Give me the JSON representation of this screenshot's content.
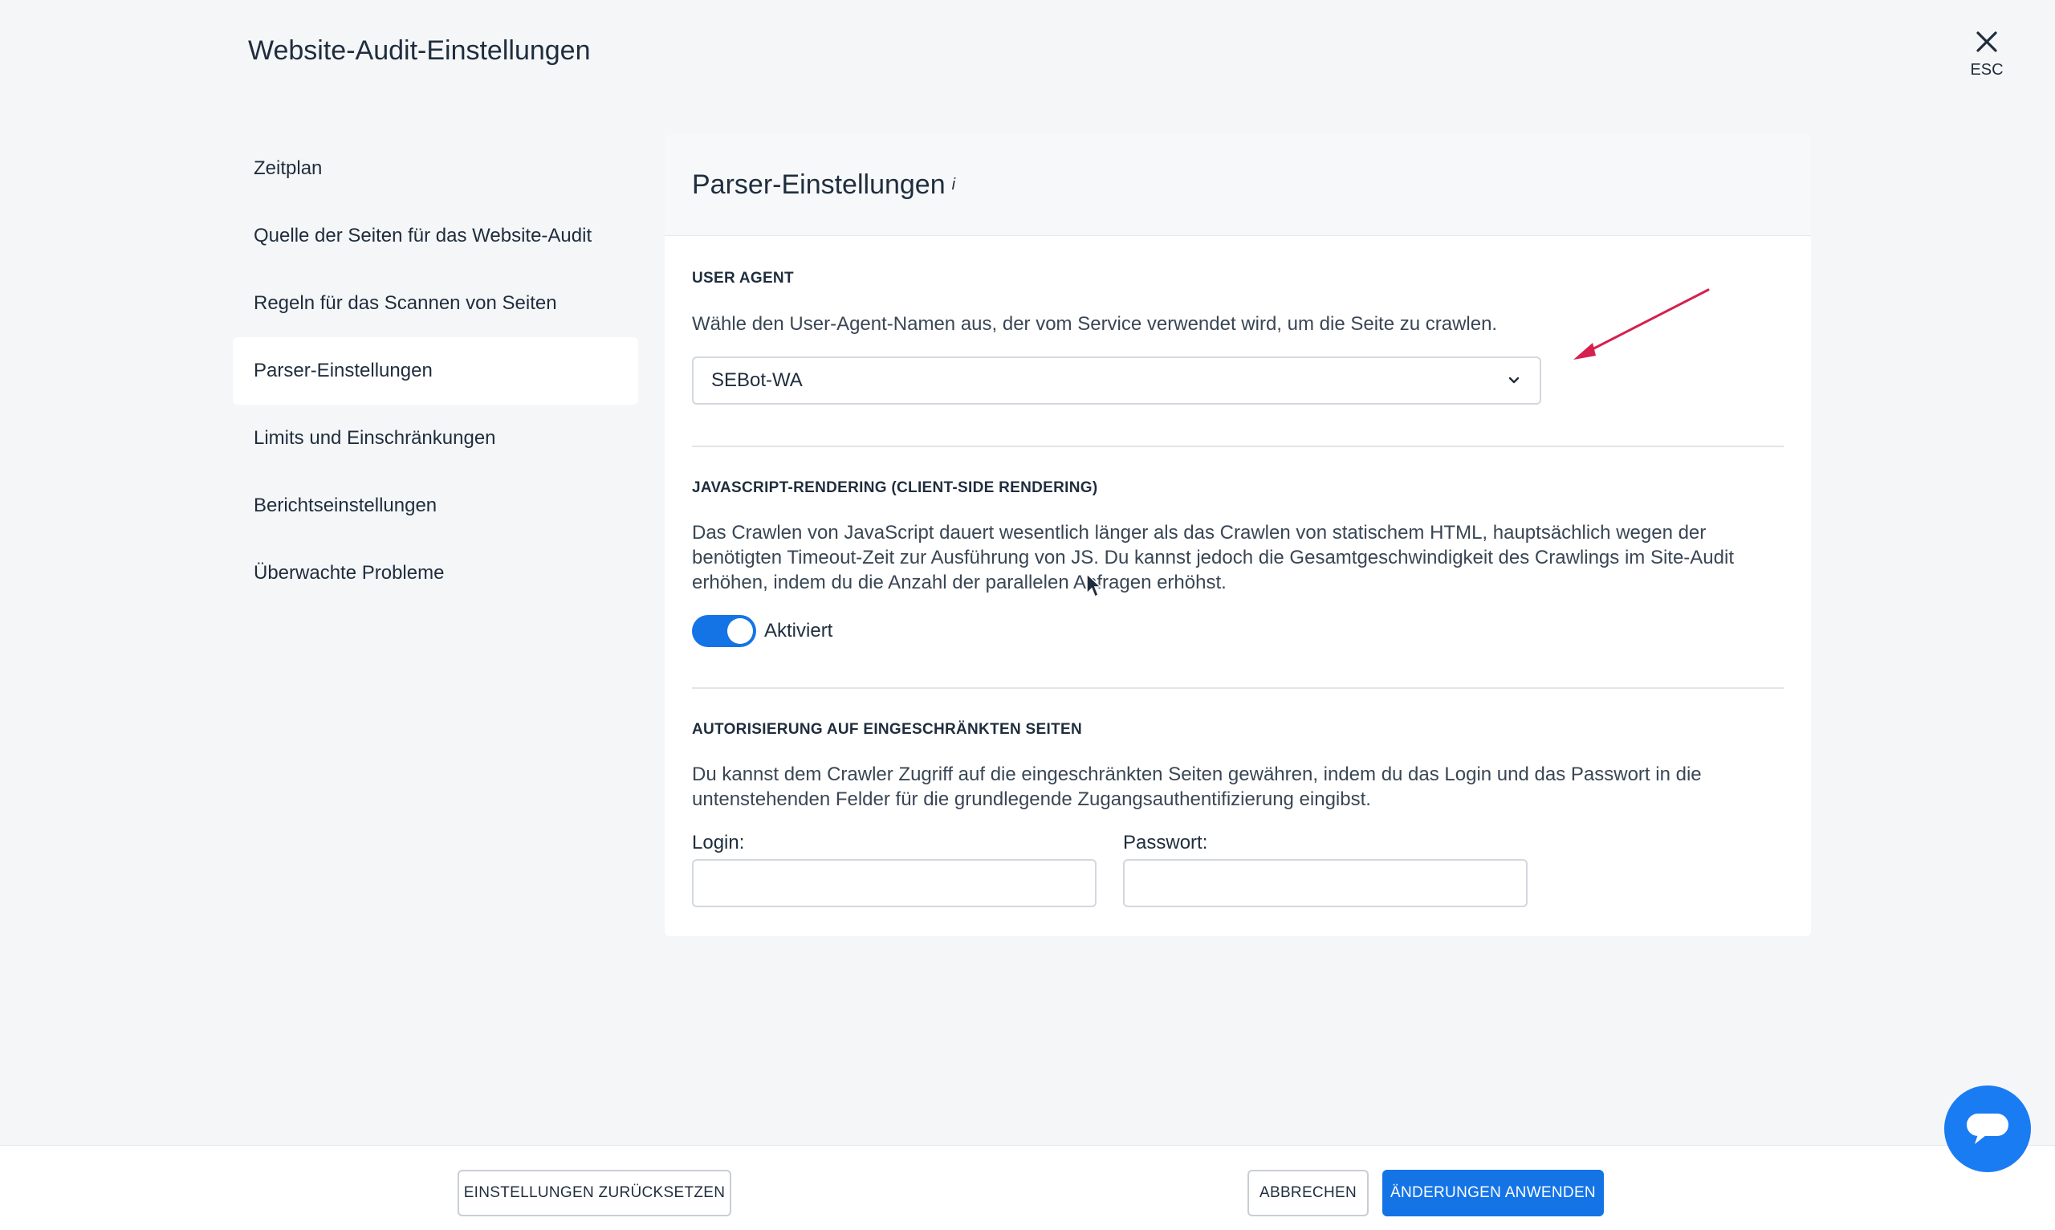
{
  "modal": {
    "title": "Website-Audit-Einstellungen",
    "close_label": "ESC"
  },
  "sidebar": {
    "items": [
      {
        "label": "Zeitplan",
        "active": false
      },
      {
        "label": "Quelle der Seiten für das Website-Audit",
        "active": false
      },
      {
        "label": "Regeln für das Scannen von Seiten",
        "active": false
      },
      {
        "label": "Parser-Einstellungen",
        "active": true
      },
      {
        "label": "Limits und Einschränkungen",
        "active": false
      },
      {
        "label": "Berichtseinstellungen",
        "active": false
      },
      {
        "label": "Überwachte Probleme",
        "active": false
      }
    ]
  },
  "panel": {
    "title": "Parser-Einstellungen",
    "info_marker": "i",
    "user_agent": {
      "label": "USER AGENT",
      "description": "Wähle den User-Agent-Namen aus, der vom Service verwendet wird, um die Seite zu crawlen.",
      "selected": "SEBot-WA"
    },
    "js_rendering": {
      "label": "JAVASCRIPT-RENDERING (CLIENT-SIDE RENDERING)",
      "description": "Das Crawlen von JavaScript dauert wesentlich länger als das Crawlen von statischem HTML, hauptsächlich wegen der benötigten Timeout-Zeit zur Ausführung von JS. Du kannst jedoch die Gesamtgeschwindigkeit des Crawlings im Site-Audit erhöhen, indem du die Anzahl der parallelen Anfragen erhöhst.",
      "toggle_on": true,
      "toggle_label": "Aktiviert"
    },
    "auth": {
      "label": "AUTORISIERUNG AUF EINGESCHRÄNKTEN SEITEN",
      "description": "Du kannst dem Crawler Zugriff auf die eingeschränkten Seiten gewähren, indem du das Login und das Passwort in die untenstehenden Felder für die grundlegende Zugangsauthentifizierung eingibst.",
      "login_label": "Login:",
      "login_value": "",
      "password_label": "Passwort:",
      "password_value": ""
    }
  },
  "footer": {
    "reset_label": "EINSTELLUNGEN ZURÜCKSETZEN",
    "cancel_label": "ABBRECHEN",
    "apply_label": "ÄNDERUNGEN ANWENDEN"
  },
  "colors": {
    "accent": "#1474e6",
    "annotation_arrow": "#d6204e",
    "background": "#f5f6f8"
  }
}
